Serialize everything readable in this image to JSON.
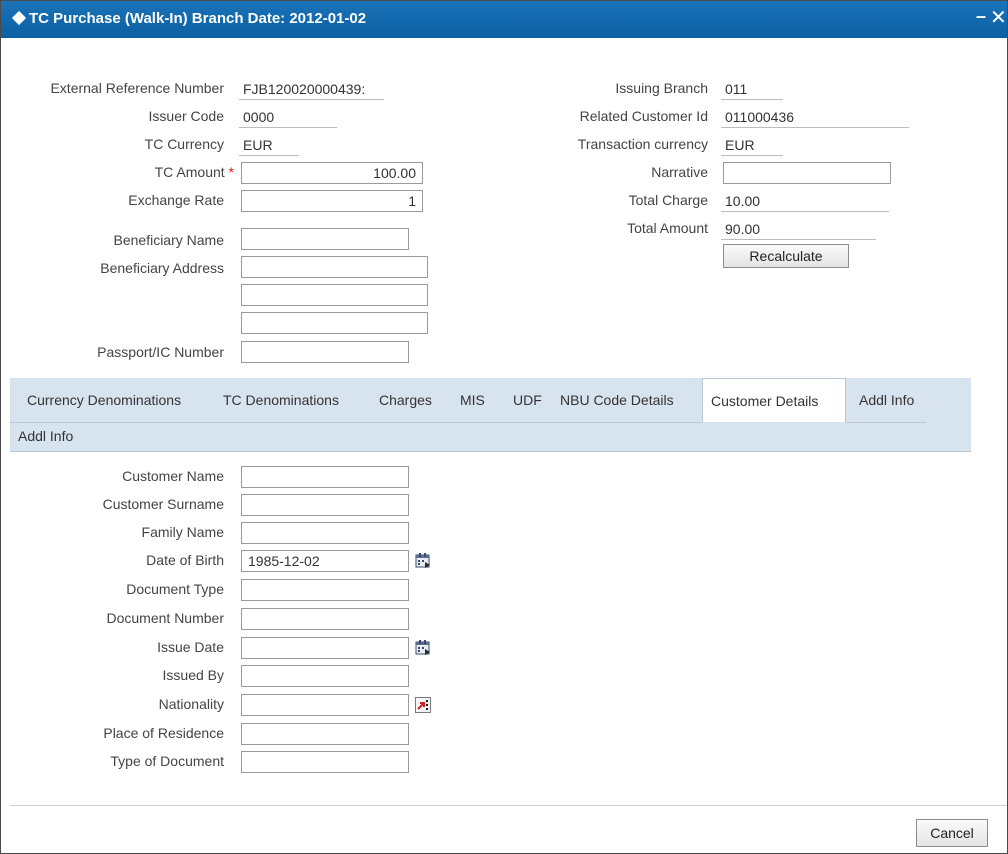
{
  "window": {
    "title": "TC Purchase (Walk-In)  Branch Date: 2012-01-02",
    "minimize_glyph": "–",
    "close_glyph": "✕"
  },
  "form_left": {
    "ext_ref_label": "External Reference Number",
    "ext_ref_value": "FJB120020000439:",
    "issuer_code_label": "Issuer Code",
    "issuer_code_value": "0000",
    "tc_currency_label": "TC Currency",
    "tc_currency_value": "EUR",
    "tc_amount_label": "TC Amount",
    "required_mark": "*",
    "tc_amount_value": "100.00",
    "exchange_rate_label": "Exchange Rate",
    "exchange_rate_value": "1",
    "beneficiary_name_label": "Beneficiary Name",
    "beneficiary_address_label": "Beneficiary Address",
    "passport_label": "Passport/IC Number"
  },
  "form_right": {
    "issuing_branch_label": "Issuing Branch",
    "issuing_branch_value": "011",
    "related_customer_label": "Related Customer Id",
    "related_customer_value": "011000436",
    "transaction_currency_label": "Transaction currency",
    "transaction_currency_value": "EUR",
    "narrative_label": "Narrative",
    "total_charge_label": "Total Charge",
    "total_charge_value": "10.00",
    "total_amount_label": "Total Amount",
    "total_amount_value": "90.00",
    "recalculate_label": "Recalculate"
  },
  "tabs": {
    "currency_denominations": "Currency Denominations",
    "tc_denominations": "TC Denominations",
    "charges": "Charges",
    "mis": "MIS",
    "udf": "UDF",
    "nbu_code_details": "NBU Code Details",
    "customer_details": "Customer Details",
    "addl_info_1": "Addl Info",
    "addl_info_2": "Addl Info"
  },
  "customer": {
    "customer_name_label": "Customer Name",
    "customer_surname_label": "Customer Surname",
    "family_name_label": "Family Name",
    "dob_label": "Date of Birth",
    "dob_value": "1985-12-02",
    "document_type_label": "Document Type",
    "document_number_label": "Document Number",
    "issue_date_label": "Issue Date",
    "issued_by_label": "Issued By",
    "nationality_label": "Nationality",
    "place_of_residence_label": "Place of Residence",
    "type_of_document_label": "Type of Document"
  },
  "footer": {
    "cancel_label": "Cancel"
  },
  "colors": {
    "titlebar": "#1a73b8",
    "tabbar": "#d8e3f0",
    "required": "#e21a1a"
  }
}
